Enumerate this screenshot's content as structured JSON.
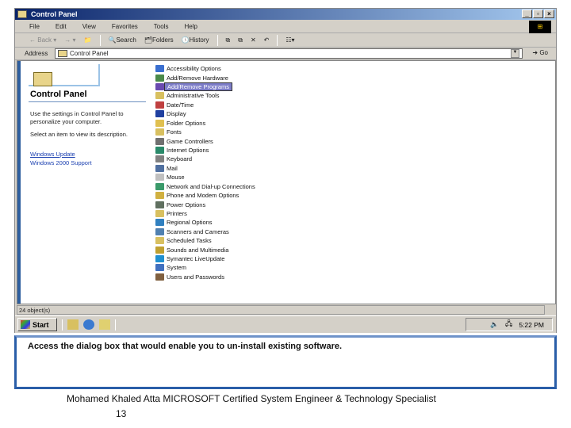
{
  "window": {
    "title": "Control Panel",
    "buttons": [
      "_",
      "▫",
      "×"
    ]
  },
  "menu": [
    "File",
    "Edit",
    "View",
    "Favorites",
    "Tools",
    "Help"
  ],
  "toolbar": {
    "back": "Back",
    "search": "Search",
    "folders": "Folders",
    "history": "History"
  },
  "address": {
    "label": "Address",
    "value": "Control Panel",
    "go": "Go"
  },
  "left_panel": {
    "title": "Control Panel",
    "desc1": "Use the settings in Control Panel to personalize your computer.",
    "desc2": "Select an item to view its description.",
    "links": [
      "Windows Update",
      "Windows 2000 Support"
    ]
  },
  "items": [
    {
      "label": "Accessibility Options",
      "color": "#3a6fd0"
    },
    {
      "label": "Add/Remove Hardware",
      "color": "#4a8a4a"
    },
    {
      "label": "Add/Remove Programs",
      "color": "#6a4ab0",
      "selected": true
    },
    {
      "label": "Administrative Tools",
      "color": "#d8c060"
    },
    {
      "label": "Date/Time",
      "color": "#c04040"
    },
    {
      "label": "Display",
      "color": "#2040a0"
    },
    {
      "label": "Folder Options",
      "color": "#e0c050"
    },
    {
      "label": "Fonts",
      "color": "#d8c060"
    },
    {
      "label": "Game Controllers",
      "color": "#707070"
    },
    {
      "label": "Internet Options",
      "color": "#2a8a6a"
    },
    {
      "label": "Keyboard",
      "color": "#808080"
    },
    {
      "label": "Mail",
      "color": "#5070a0"
    },
    {
      "label": "Mouse",
      "color": "#c0c0c0"
    },
    {
      "label": "Network and Dial-up Connections",
      "color": "#3a9a6a"
    },
    {
      "label": "Phone and Modem Options",
      "color": "#d0b040"
    },
    {
      "label": "Power Options",
      "color": "#607060"
    },
    {
      "label": "Printers",
      "color": "#d8c060"
    },
    {
      "label": "Regional Options",
      "color": "#3080c0"
    },
    {
      "label": "Scanners and Cameras",
      "color": "#5080b0"
    },
    {
      "label": "Scheduled Tasks",
      "color": "#d8c060"
    },
    {
      "label": "Sounds and Multimedia",
      "color": "#c0a030"
    },
    {
      "label": "Symantec LiveUpdate",
      "color": "#2090d0"
    },
    {
      "label": "System",
      "color": "#4070c0"
    },
    {
      "label": "Users and Passwords",
      "color": "#806040"
    }
  ],
  "status": "24 object(s)",
  "taskbar": {
    "start": "Start",
    "clock": "5:22 PM"
  },
  "question": "Access the dialog box that would enable you to un-install existing software.",
  "footer": "Mohamed Khaled Atta MICROSOFT Certified System Engineer & Technology Specialist",
  "page_number": "13"
}
